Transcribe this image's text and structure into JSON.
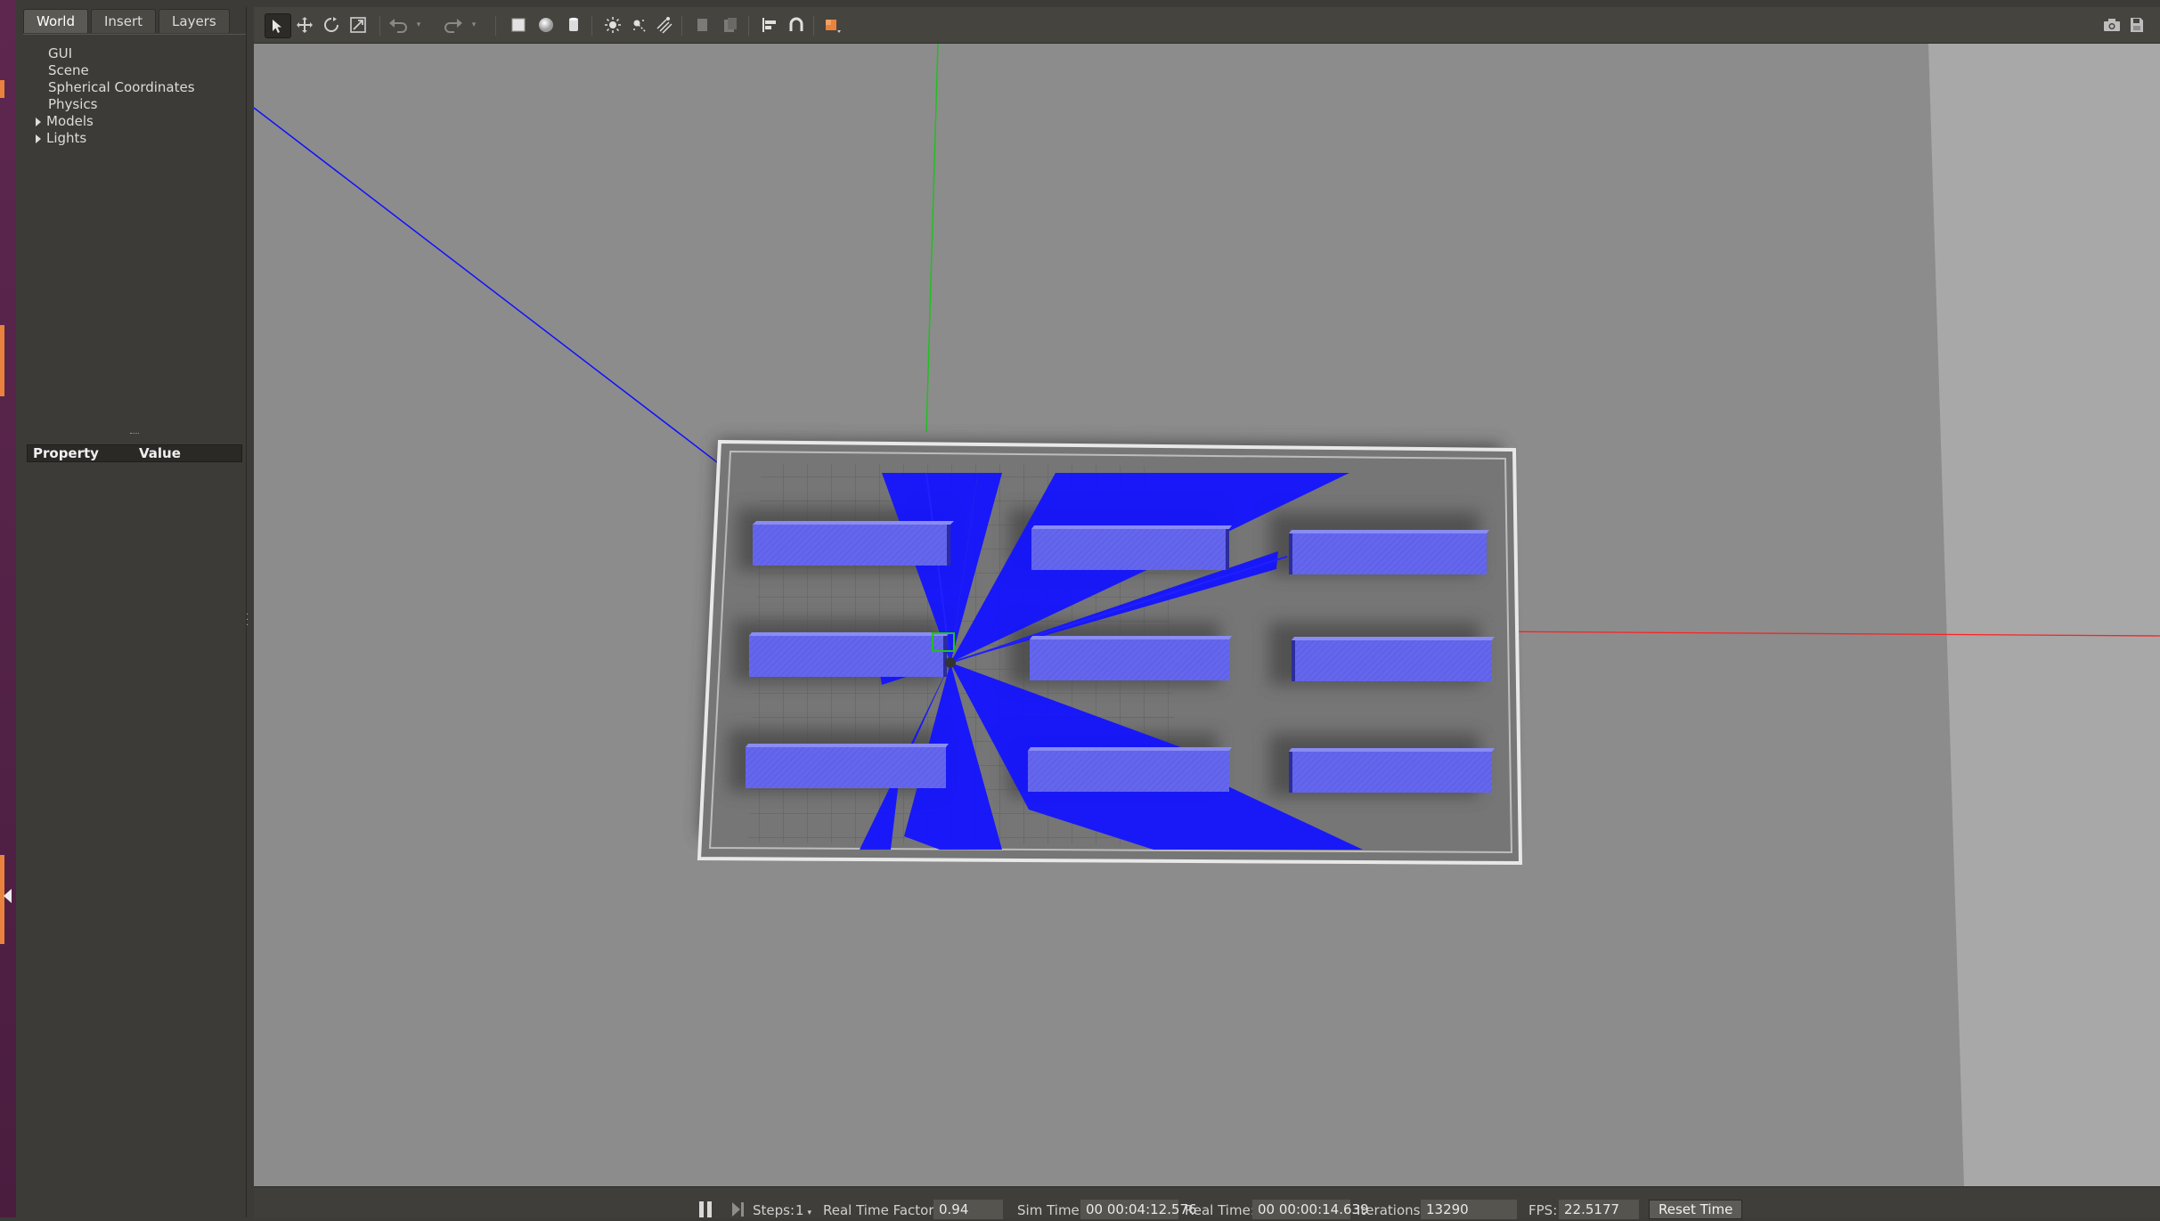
{
  "left_panel": {
    "tabs": [
      "World",
      "Insert",
      "Layers"
    ],
    "world_tree": {
      "items": [
        "GUI",
        "Scene",
        "Spherical Coordinates",
        "Physics"
      ],
      "expandable": [
        "Models",
        "Lights"
      ]
    },
    "properties": {
      "col_property": "Property",
      "col_value": "Value"
    }
  },
  "toolbar": {
    "tools": [
      "select-arrow-icon",
      "translate-icon",
      "rotate-icon",
      "scale-icon",
      "undo-icon",
      "redo-icon",
      "box-icon",
      "sphere-icon",
      "cylinder-icon",
      "point-light-icon",
      "spot-light-icon",
      "directional-light-icon",
      "copy-icon",
      "paste-icon",
      "align-icon",
      "snap-icon",
      "view-angle-icon",
      "screenshot-icon",
      "log-icon"
    ],
    "accent_color": "#e8823c"
  },
  "statusbar": {
    "steps_label": "Steps:",
    "steps_value": "1",
    "rtf_label": "Real Time Factor:",
    "rtf_value": "0.94",
    "sim_time_label": "Sim Time:",
    "sim_time_value": "00 00:04:12.576",
    "real_time_label": "Real Time:",
    "real_time_value": "00 00:00:14.639",
    "iterations_label": "Iterations:",
    "iterations_value": "13290",
    "fps_label": "FPS:",
    "fps_value": "22.5177",
    "reset_label": "Reset Time"
  },
  "scene": {
    "ground_color": "#8c8c8c",
    "shelf_color": "#6b6ef0",
    "laser_color": "#1414ff",
    "axis_x_color": "#ff2020",
    "axis_y_color": "#20c020",
    "axis_z_color": "#1010ff"
  }
}
